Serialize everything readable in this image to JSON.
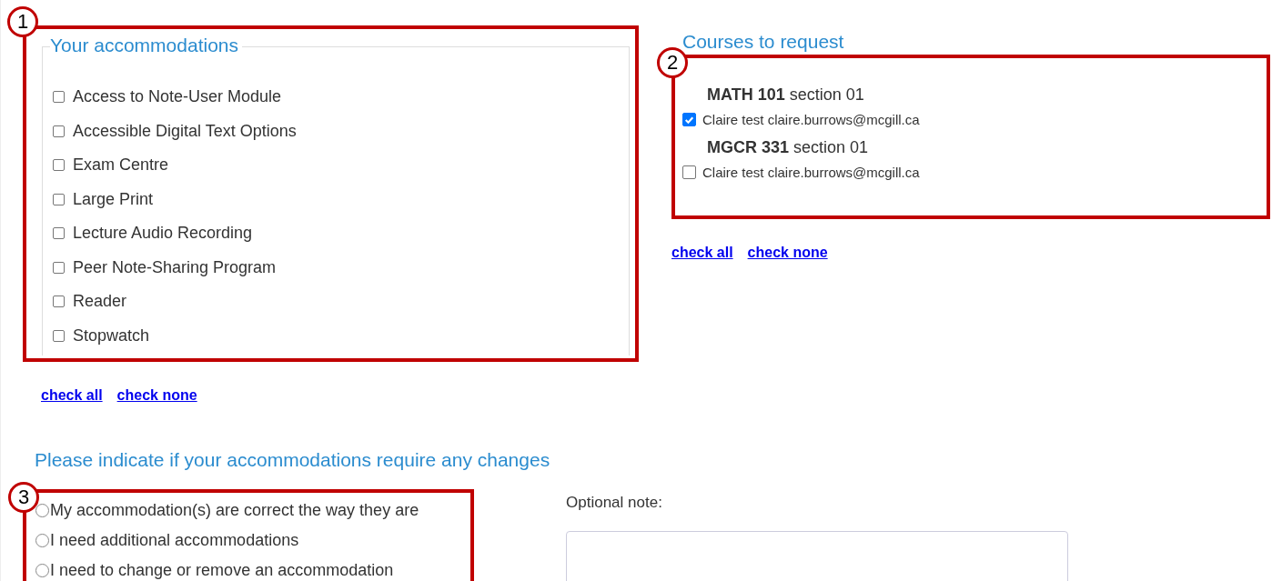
{
  "accommodations": {
    "legend": "Your accommodations",
    "marker": "1",
    "items": [
      {
        "label": "Access to Note-User Module",
        "checked": false
      },
      {
        "label": "Accessible Digital Text Options",
        "checked": false
      },
      {
        "label": "Exam Centre",
        "checked": false
      },
      {
        "label": "Large Print",
        "checked": false
      },
      {
        "label": "Lecture Audio Recording",
        "checked": false
      },
      {
        "label": "Peer Note-Sharing Program",
        "checked": false
      },
      {
        "label": "Reader",
        "checked": false
      },
      {
        "label": "Stopwatch",
        "checked": false
      }
    ],
    "links": [
      "check all",
      "check none"
    ]
  },
  "courses": {
    "legend": "Courses to request",
    "marker": "2",
    "items": [
      {
        "heading": "**MATH 101** section 01",
        "label": "Claire test claire.burrows@mcgill.ca",
        "checked": true
      },
      {
        "heading": "**MGCR 331** section 01",
        "label": "Claire test claire.burrows@mcgill.ca",
        "checked": false
      }
    ],
    "links": [
      "check all",
      "check none"
    ]
  },
  "changes": {
    "legend": "Please indicate if your accommodations require any changes",
    "marker": "3",
    "options": [
      {
        "label": "My accommodation(s) are correct the way they are",
        "selected": false
      },
      {
        "label": "I need additional accommodations",
        "selected": false
      },
      {
        "label": "I need to change or remove an accommodation",
        "selected": false
      }
    ],
    "note_label": "Optional note:"
  }
}
